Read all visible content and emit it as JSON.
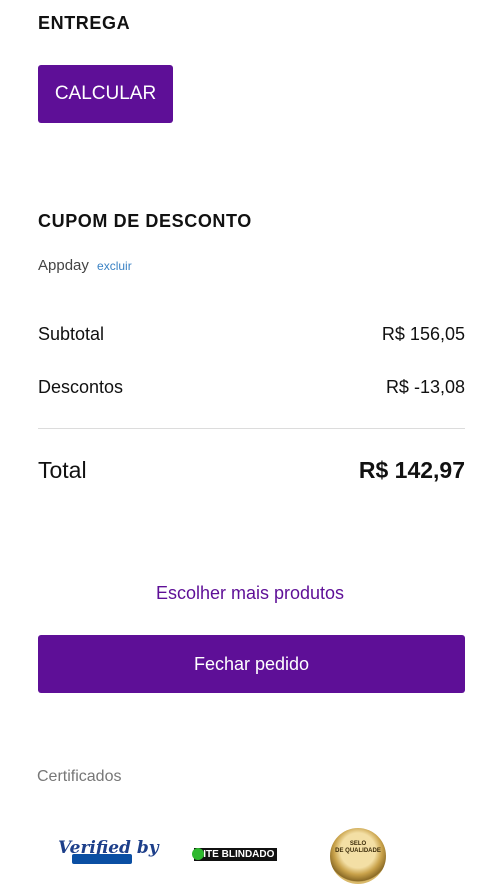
{
  "delivery": {
    "title": "ENTREGA",
    "calculate_label": "CALCULAR"
  },
  "coupon": {
    "title": "CUPOM DE DESCONTO",
    "code": "Appday",
    "remove_label": "excluir"
  },
  "summary": {
    "subtotal_label": "Subtotal",
    "subtotal_value": "R$ 156,05",
    "discounts_label": "Descontos",
    "discounts_value": "R$ -13,08",
    "total_label": "Total",
    "total_value": "R$ 142,97"
  },
  "actions": {
    "more_products_label": "Escolher mais produtos",
    "checkout_label": "Fechar pedido"
  },
  "certificates": {
    "title": "Certificados",
    "badges": [
      {
        "icon": "verified-by-badge-icon",
        "label": "Verified by"
      },
      {
        "icon": "site-blindado-badge-icon",
        "label": "SITE BLINDADO"
      },
      {
        "icon": "quality-seal-icon",
        "label_line1": "SELO",
        "label_line2": "DE QUALIDADE"
      }
    ]
  },
  "colors": {
    "primary": "#5e0f97",
    "link": "#3a82c4",
    "divider": "#dcdcdc"
  }
}
